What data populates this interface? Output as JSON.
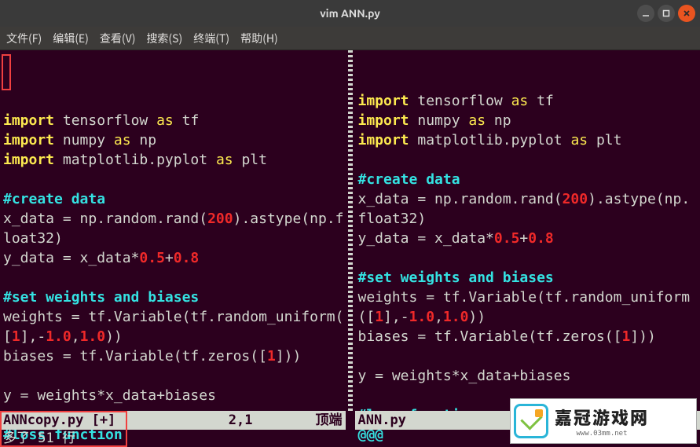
{
  "window": {
    "title": "vim ANN.py"
  },
  "menubar": {
    "items": [
      "文件(F)",
      "编辑(E)",
      "查看(V)",
      "搜索(S)",
      "终端(T)",
      "帮助(H)"
    ]
  },
  "left_pane": {
    "lines": [
      [],
      [
        {
          "c": "kw",
          "t": "import"
        },
        {
          "c": "tx",
          "t": " tensorflow "
        },
        {
          "c": "ok",
          "t": "as"
        },
        {
          "c": "tx",
          "t": " tf"
        }
      ],
      [
        {
          "c": "kw",
          "t": "import"
        },
        {
          "c": "tx",
          "t": " numpy "
        },
        {
          "c": "ok",
          "t": "as"
        },
        {
          "c": "tx",
          "t": " np"
        }
      ],
      [
        {
          "c": "kw",
          "t": "import"
        },
        {
          "c": "tx",
          "t": " matplotlib.pyplot "
        },
        {
          "c": "ok",
          "t": "as"
        },
        {
          "c": "tx",
          "t": " plt"
        }
      ],
      [],
      [
        {
          "c": "cm",
          "t": "#create data"
        }
      ],
      [
        {
          "c": "tx",
          "t": "x_data = np.random.rand("
        },
        {
          "c": "nm",
          "t": "200"
        },
        {
          "c": "tx",
          "t": ").astype(np.f"
        }
      ],
      [
        {
          "c": "tx",
          "t": "loat32)"
        }
      ],
      [
        {
          "c": "tx",
          "t": "y_data = x_data*"
        },
        {
          "c": "nm",
          "t": "0.5"
        },
        {
          "c": "tx",
          "t": "+"
        },
        {
          "c": "nm",
          "t": "0.8"
        }
      ],
      [],
      [
        {
          "c": "cm",
          "t": "#set weights and biases"
        }
      ],
      [
        {
          "c": "tx",
          "t": "weights = tf.Variable(tf.random_uniform("
        }
      ],
      [
        {
          "c": "tx",
          "t": "["
        },
        {
          "c": "nm",
          "t": "1"
        },
        {
          "c": "tx",
          "t": "],-"
        },
        {
          "c": "nm",
          "t": "1.0"
        },
        {
          "c": "tx",
          "t": ","
        },
        {
          "c": "nm",
          "t": "1.0"
        },
        {
          "c": "tx",
          "t": "))"
        }
      ],
      [
        {
          "c": "tx",
          "t": "biases = tf.Variable(tf.zeros(["
        },
        {
          "c": "nm",
          "t": "1"
        },
        {
          "c": "tx",
          "t": "]))"
        }
      ],
      [],
      [
        {
          "c": "tx",
          "t": "y = weights*x_data+biases"
        }
      ],
      [],
      [
        {
          "c": "cm",
          "t": "#loss function"
        }
      ]
    ],
    "status": {
      "file": "ANNcopy.py [+]",
      "pos": "2,1",
      "view": "顶端"
    }
  },
  "right_pane": {
    "lines": [
      [
        {
          "c": "kw",
          "t": "import"
        },
        {
          "c": "tx",
          "t": " tensorflow "
        },
        {
          "c": "ok",
          "t": "as"
        },
        {
          "c": "tx",
          "t": " tf"
        }
      ],
      [
        {
          "c": "kw",
          "t": "import"
        },
        {
          "c": "tx",
          "t": " numpy "
        },
        {
          "c": "ok",
          "t": "as"
        },
        {
          "c": "tx",
          "t": " np"
        }
      ],
      [
        {
          "c": "kw",
          "t": "import"
        },
        {
          "c": "tx",
          "t": " matplotlib.pyplot "
        },
        {
          "c": "ok",
          "t": "as"
        },
        {
          "c": "tx",
          "t": " plt"
        }
      ],
      [],
      [
        {
          "c": "cm",
          "t": "#create data"
        }
      ],
      [
        {
          "c": "tx",
          "t": "x_data = np.random.rand("
        },
        {
          "c": "nm",
          "t": "200"
        },
        {
          "c": "tx",
          "t": ").astype(np."
        }
      ],
      [
        {
          "c": "tx",
          "t": "float32)"
        }
      ],
      [
        {
          "c": "tx",
          "t": "y_data = x_data*"
        },
        {
          "c": "nm",
          "t": "0.5"
        },
        {
          "c": "tx",
          "t": "+"
        },
        {
          "c": "nm",
          "t": "0.8"
        }
      ],
      [],
      [
        {
          "c": "cm",
          "t": "#set weights and biases"
        }
      ],
      [
        {
          "c": "tx",
          "t": "weights = tf.Variable(tf.random_uniform"
        }
      ],
      [
        {
          "c": "tx",
          "t": "(["
        },
        {
          "c": "nm",
          "t": "1"
        },
        {
          "c": "tx",
          "t": "],-"
        },
        {
          "c": "nm",
          "t": "1.0"
        },
        {
          "c": "tx",
          "t": ","
        },
        {
          "c": "nm",
          "t": "1.0"
        },
        {
          "c": "tx",
          "t": "))"
        }
      ],
      [
        {
          "c": "tx",
          "t": "biases = tf.Variable(tf.zeros(["
        },
        {
          "c": "nm",
          "t": "1"
        },
        {
          "c": "tx",
          "t": "]))"
        }
      ],
      [],
      [
        {
          "c": "tx",
          "t": "y = weights*x_data+biases"
        }
      ],
      [],
      [
        {
          "c": "cm",
          "t": "#loss function"
        }
      ],
      [
        {
          "c": "cm",
          "t": "@@@"
        }
      ]
    ],
    "status": {
      "file": "ANN.py",
      "pos": "",
      "view": ""
    }
  },
  "cmdline": {
    "msg": "多了 51 行"
  },
  "logo": {
    "cn": "嘉冠游戏网",
    "url": "www.03mm.net"
  }
}
